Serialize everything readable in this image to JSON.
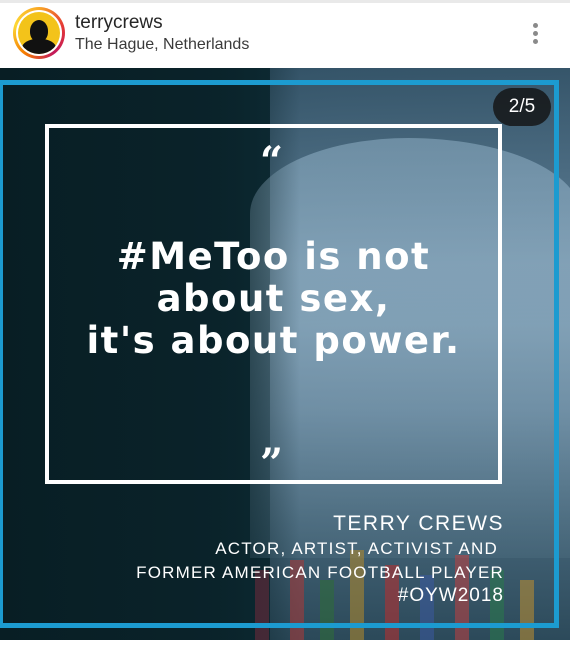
{
  "post": {
    "username": "terrycrews",
    "location": "The Hague, Netherlands",
    "more_icon": "more-vertical-icon",
    "avatar": "avatar-silhouette",
    "pager": "2/5"
  },
  "quote": {
    "open_mark": "“",
    "close_mark": "”",
    "lines": [
      "#MeToo is not",
      "about sex,",
      "it's about power."
    ]
  },
  "credit": {
    "name": "TERRY CREWS",
    "role_line1": "ACTOR, ARTIST, ACTIVIST AND",
    "role_line2": "FORMER AMERICAN FOOTBALL PLAYER",
    "hashtag": "#OYW2018"
  },
  "colors": {
    "accent_frame": "#1c9bd0",
    "background_dark": "#0c2a33",
    "text": "#ffffff"
  }
}
